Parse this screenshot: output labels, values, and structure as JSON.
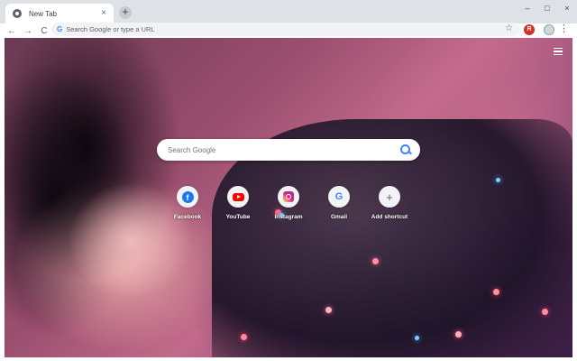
{
  "browser": {
    "tab_title": "New Tab",
    "tab_close": "×",
    "new_tab_symbol": "+",
    "window_controls": [
      "–",
      "□",
      "×"
    ],
    "nav": {
      "back": "←",
      "forward": "→",
      "reload": "C"
    },
    "omnibox": {
      "g_mark": "G",
      "placeholder": "Search Google or type a URL",
      "star": "☆"
    },
    "extension_label": "R",
    "menu": "⋮"
  },
  "ntp": {
    "search_placeholder": "Search Google",
    "shortcuts": [
      {
        "label": "Facebook",
        "icon": "facebook-icon",
        "glyph": "f"
      },
      {
        "label": "YouTube",
        "icon": "youtube-icon",
        "glyph": ""
      },
      {
        "label": "Instagram",
        "icon": "instagram-icon",
        "glyph": ""
      },
      {
        "label": "Gmail",
        "icon": "google-icon",
        "glyph": "G"
      },
      {
        "label": "Add shortcut",
        "icon": "plus-icon",
        "glyph": "+"
      }
    ]
  },
  "colors": {
    "accent": "#4285f4",
    "tabstrip": "#dee1e6",
    "omnibox": "#f1f3f4"
  }
}
